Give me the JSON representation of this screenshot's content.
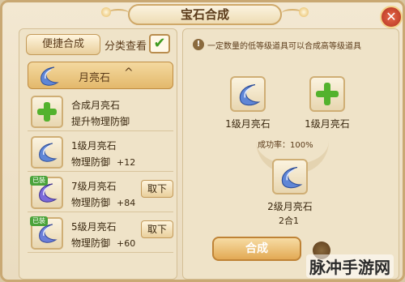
{
  "window": {
    "title": "宝石合成",
    "close_label": "✕"
  },
  "left": {
    "quick_button": "便捷合成",
    "classify_label": "分类查看",
    "checkbox_mark": "✔",
    "category": {
      "label": "月亮石",
      "caret": "^"
    },
    "rows": [
      {
        "name": "合成月亮石",
        "sub": "提升物理防御",
        "bonus": "",
        "action": ""
      },
      {
        "name": "1级月亮石",
        "sub": "物理防御",
        "bonus": "+12",
        "action": ""
      },
      {
        "name": "7级月亮石",
        "sub": "物理防御",
        "bonus": "+84",
        "action": "取下",
        "tag": "已装"
      },
      {
        "name": "5级月亮石",
        "sub": "物理防御",
        "bonus": "+60",
        "action": "取下",
        "tag": "已装"
      }
    ]
  },
  "right": {
    "info_glyph": "!",
    "hint": "一定数量的低等级道具可以合成高等级道具",
    "slot_a_label": "1级月亮石",
    "slot_b_label": "1级月亮石",
    "success_rate": "成功率：100%",
    "result_label": "2级月亮石",
    "merge_note": "2合1",
    "merge_button": "合成"
  },
  "watermark": "脉冲手游网",
  "colors": {
    "gem_blue": "#4a6fc7",
    "plus_green": "#53b22d",
    "panel": "#efe3c8"
  }
}
